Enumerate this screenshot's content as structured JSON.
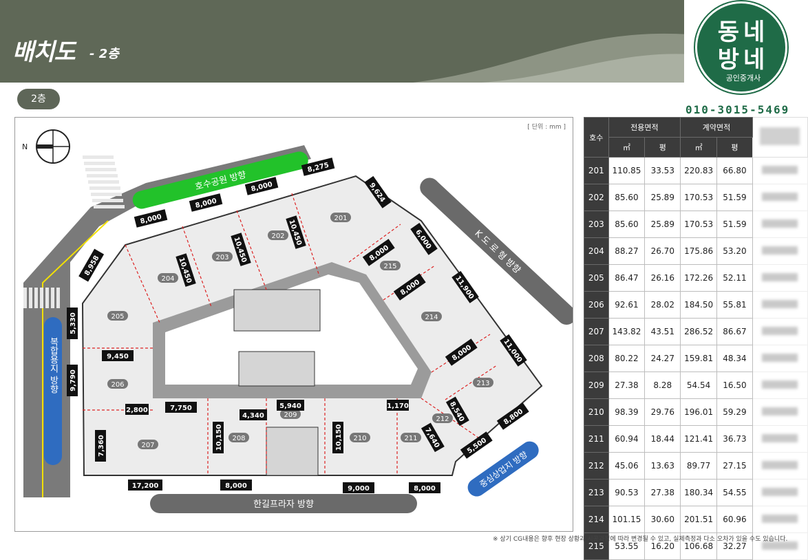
{
  "header": {
    "title": "배치도",
    "subtitle": "- 2층"
  },
  "logo": {
    "line1": "동네",
    "line2": "방네",
    "sub": "공인중개사",
    "phone": "010-3015-5469"
  },
  "floor_badge": "2층",
  "plan": {
    "unit_note": "[ 단위 : mm ]",
    "compass": "N",
    "roads": {
      "top": "호수공원 방향",
      "left": "복합용지 방향",
      "bottom": "한길프라자 방향",
      "bottom_right": "중심상업지 방향",
      "right": "K 도 로 형 방향"
    },
    "units": [
      "201",
      "202",
      "203",
      "204",
      "205",
      "206",
      "207",
      "208",
      "209",
      "210",
      "211",
      "212",
      "213",
      "214",
      "215"
    ],
    "dimensions": [
      "8,000",
      "8,000",
      "8,000",
      "8,275",
      "9,624",
      "6,000",
      "11,900",
      "11,000",
      "8,800",
      "5,500",
      "8,958",
      "5,330",
      "9,450",
      "9,790",
      "2,800",
      "7,750",
      "7,360",
      "17,200",
      "8,000",
      "9,000",
      "8,000",
      "10,150",
      "4,340",
      "5,940",
      "10,150",
      "1,170",
      "8,540",
      "7,640",
      "10,450",
      "10,450",
      "10,450",
      "8,000",
      "8,000",
      "8,000"
    ]
  },
  "table": {
    "headers": {
      "unit": "호수",
      "exclusive": "전용면적",
      "contract": "계약면적",
      "m2": "㎡",
      "py": "평"
    },
    "rows": [
      [
        "201",
        "110.85",
        "33.53",
        "220.83",
        "66.80"
      ],
      [
        "202",
        "85.60",
        "25.89",
        "170.53",
        "51.59"
      ],
      [
        "203",
        "85.60",
        "25.89",
        "170.53",
        "51.59"
      ],
      [
        "204",
        "88.27",
        "26.70",
        "175.86",
        "53.20"
      ],
      [
        "205",
        "86.47",
        "26.16",
        "172.26",
        "52.11"
      ],
      [
        "206",
        "92.61",
        "28.02",
        "184.50",
        "55.81"
      ],
      [
        "207",
        "143.82",
        "43.51",
        "286.52",
        "86.67"
      ],
      [
        "208",
        "80.22",
        "24.27",
        "159.81",
        "48.34"
      ],
      [
        "209",
        "27.38",
        "8.28",
        "54.54",
        "16.50"
      ],
      [
        "210",
        "98.39",
        "29.76",
        "196.01",
        "59.29"
      ],
      [
        "211",
        "60.94",
        "18.44",
        "121.41",
        "36.73"
      ],
      [
        "212",
        "45.06",
        "13.63",
        "89.77",
        "27.15"
      ],
      [
        "213",
        "90.53",
        "27.38",
        "180.34",
        "54.55"
      ],
      [
        "214",
        "101.15",
        "30.60",
        "201.51",
        "60.96"
      ],
      [
        "215",
        "53.55",
        "16.20",
        "106.68",
        "32.27"
      ]
    ]
  },
  "footnote": "※ 상기 CG내용은 향후 현장 상황과 시공과정에 따라 변경될 수 있고, 실제측정과 다소 오차가 있을 수도 있습니다."
}
